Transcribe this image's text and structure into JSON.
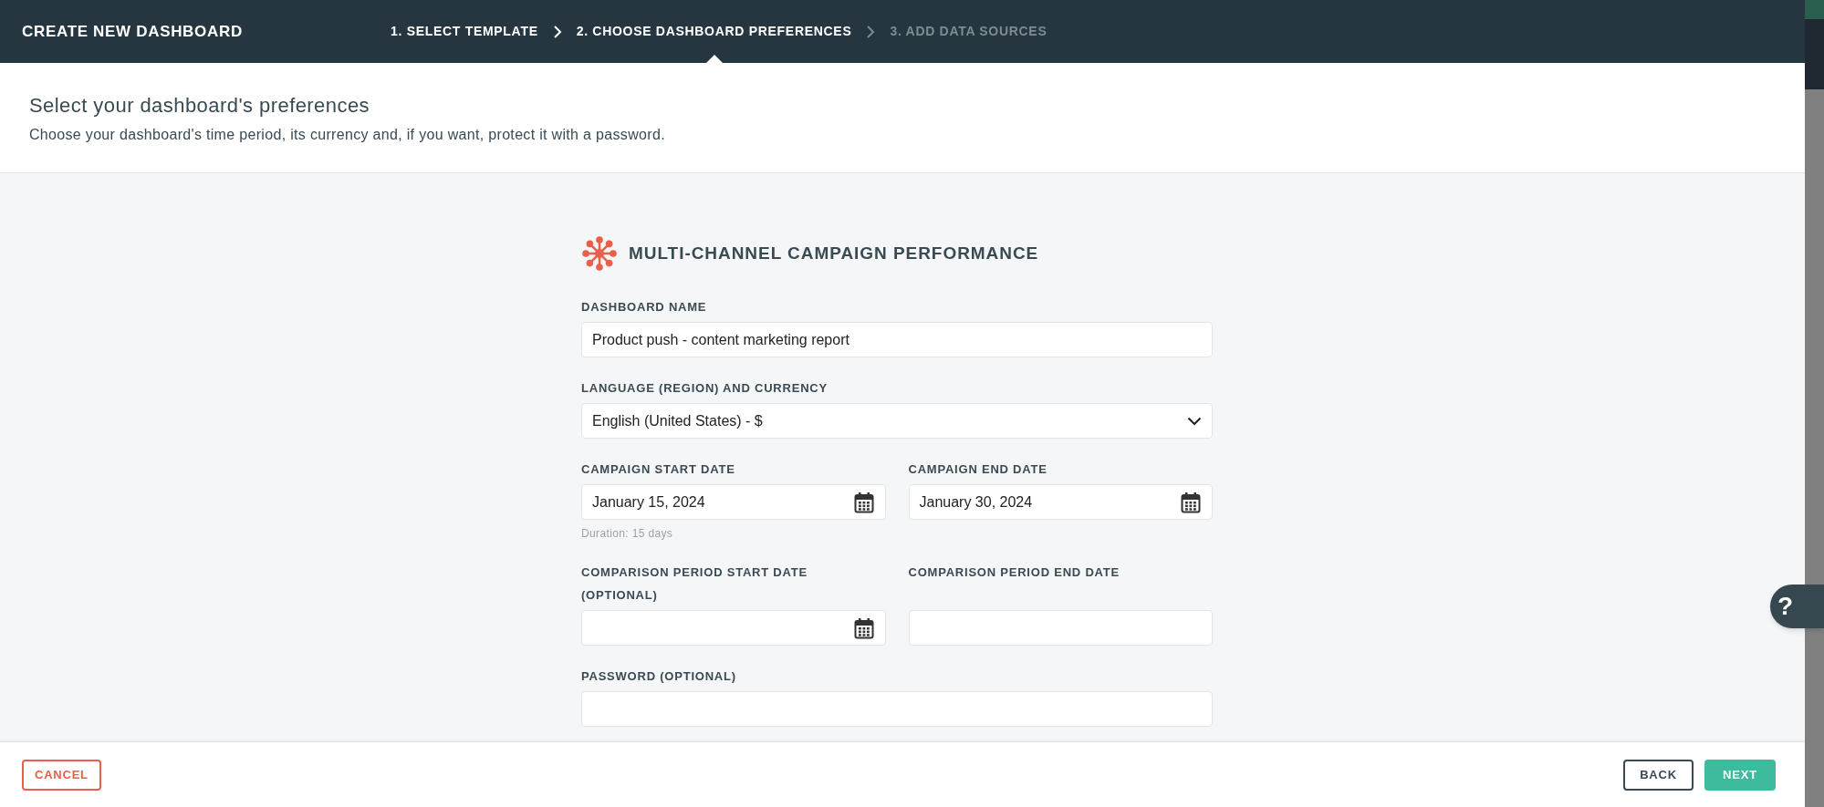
{
  "window": {
    "title": "CREATE NEW DASHBOARD"
  },
  "steps": [
    {
      "label": "1. SELECT TEMPLATE",
      "selected": false,
      "disabled": false
    },
    {
      "label": "2. CHOOSE DASHBOARD PREFERENCES",
      "selected": true,
      "disabled": false
    },
    {
      "label": "3. ADD DATA SOURCES",
      "selected": false,
      "disabled": true
    }
  ],
  "header": {
    "title": "Select your dashboard's preferences",
    "subtitle": "Choose your dashboard's time period, its currency and, if you want, protect it with a password."
  },
  "form": {
    "template_name": "MULTI-CHANNEL CAMPAIGN PERFORMANCE",
    "rows": [
      {
        "fields": [
          {
            "kind": "text",
            "label": "DASHBOARD NAME",
            "value": "Product push - content marketing report"
          }
        ]
      },
      {
        "fields": [
          {
            "kind": "select",
            "label": "LANGUAGE (REGION) AND CURRENCY",
            "value": "English (United States) - $"
          }
        ]
      },
      {
        "fields": [
          {
            "kind": "date",
            "label": "CAMPAIGN START DATE",
            "value": "January 15, 2024",
            "hint": "Duration: 15 days"
          },
          {
            "kind": "date",
            "label": "CAMPAIGN END DATE",
            "value": "January 30, 2024"
          }
        ]
      },
      {
        "fields": [
          {
            "kind": "date",
            "label": "COMPARISON PERIOD START DATE (OPTIONAL)"
          },
          {
            "kind": "text",
            "label": "COMPARISON PERIOD END DATE"
          }
        ]
      },
      {
        "fields": [
          {
            "kind": "password",
            "label": "PASSWORD (OPTIONAL)"
          }
        ]
      }
    ]
  },
  "help": {
    "label": "?"
  },
  "footer": {
    "cancel": "CANCEL",
    "back": "BACK",
    "next": "NEXT"
  }
}
